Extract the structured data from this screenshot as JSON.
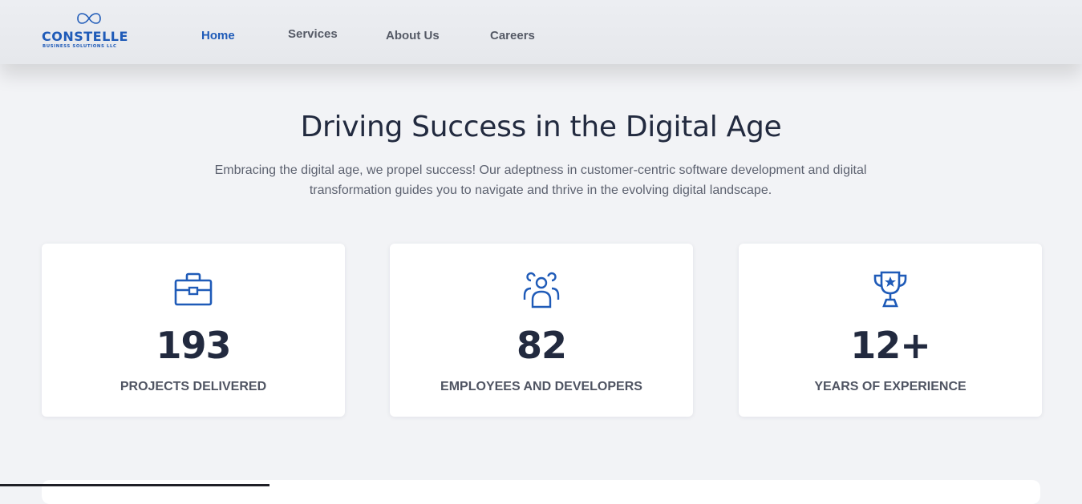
{
  "brand": {
    "name": "CONSTELLE",
    "tagline": "BUSINESS SOLUTIONS LLC",
    "logo_icon": "infinity-icon",
    "color": "#1f5bb8"
  },
  "nav": {
    "items": [
      {
        "label": "Home",
        "active": true
      },
      {
        "label": "Services",
        "active": false
      },
      {
        "label": "About Us",
        "active": false
      },
      {
        "label": "Careers",
        "active": false
      }
    ]
  },
  "hero": {
    "title": "Driving Success in the Digital Age",
    "description": "Embracing the digital age, we propel success! Our adeptness in customer-centric software development and digital transformation guides you to navigate and thrive in the evolving digital landscape."
  },
  "stats": [
    {
      "icon": "briefcase-icon",
      "value": "193",
      "label": "PROJECTS DELIVERED"
    },
    {
      "icon": "team-icon",
      "value": "82",
      "label": "EMPLOYEES AND DEVELOPERS"
    },
    {
      "icon": "trophy-icon",
      "value": "12+",
      "label": "YEARS OF EXPERIENCE"
    }
  ],
  "colors": {
    "accent": "#1f5bb8",
    "text_dark": "#222a3f",
    "text_muted": "#5d6270",
    "background": "#f2f3f6"
  }
}
